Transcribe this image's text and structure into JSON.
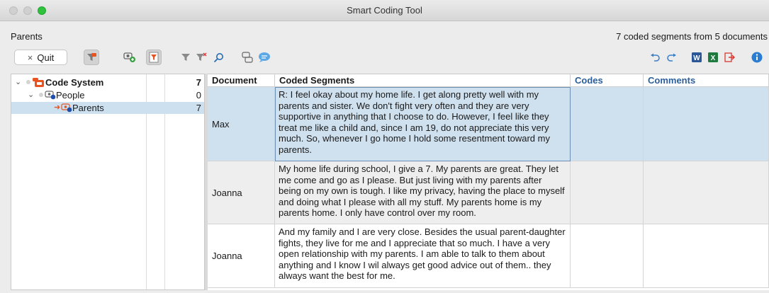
{
  "window": {
    "title": "Smart Coding Tool"
  },
  "info": {
    "left": "Parents",
    "right": "7 coded segments from 5 documents"
  },
  "toolbar": {
    "quit_label": "Quit",
    "quit_icon": "×",
    "icons": [
      "code-filter-icon",
      "add-code-icon",
      "filter-active-icon",
      "filter-icon",
      "clear-filter-icon",
      "search-icon",
      "code-view-icon",
      "comment-icon",
      "undo-icon",
      "redo-icon",
      "word-export-icon",
      "excel-export-icon",
      "export-icon",
      "info-icon"
    ]
  },
  "tree": [
    {
      "label": "Code System",
      "count": "7",
      "bold": true
    },
    {
      "label": "People",
      "count": "0",
      "bold": false
    },
    {
      "label": "Parents",
      "count": "7",
      "bold": false
    }
  ],
  "table": {
    "headers": [
      "Document",
      "Coded Segments",
      "Codes",
      "Comments"
    ],
    "rows": [
      {
        "document": "Max",
        "segment": "R: I feel okay about my home life. I get along pretty well with my parents and sister. We don't fight very often and they are very supportive in anything that I choose to do. However, I feel like they treat me like a child and, since I am 19, do not appreciate this very much. So, whenever I go home I hold some resentment toward my parents.",
        "codes": "",
        "comments": ""
      },
      {
        "document": "Joanna",
        "segment": "My home life during school, I give a 7. My parents are great. They let me come and go as I please. But just living with my parents after being on my own is tough. I like my privacy, having the place to myself and doing what I please with all my stuff. My parents home is my parents home. I only have control over my room.",
        "codes": "",
        "comments": ""
      },
      {
        "document": "Joanna",
        "segment": "And my family and I are very close. Besides the usual parent-daughter fights, they live for me and I appreciate that so much. I have a very open relationship with my parents. I am able to talk to them about anything and I know I wil always get good advice out of them.. they always want the best for me.",
        "codes": "",
        "comments": ""
      }
    ]
  },
  "colors": {
    "accent_blue": "#2a5e9c",
    "code_orange": "#e8531f",
    "selection": "#cfe0ee"
  }
}
